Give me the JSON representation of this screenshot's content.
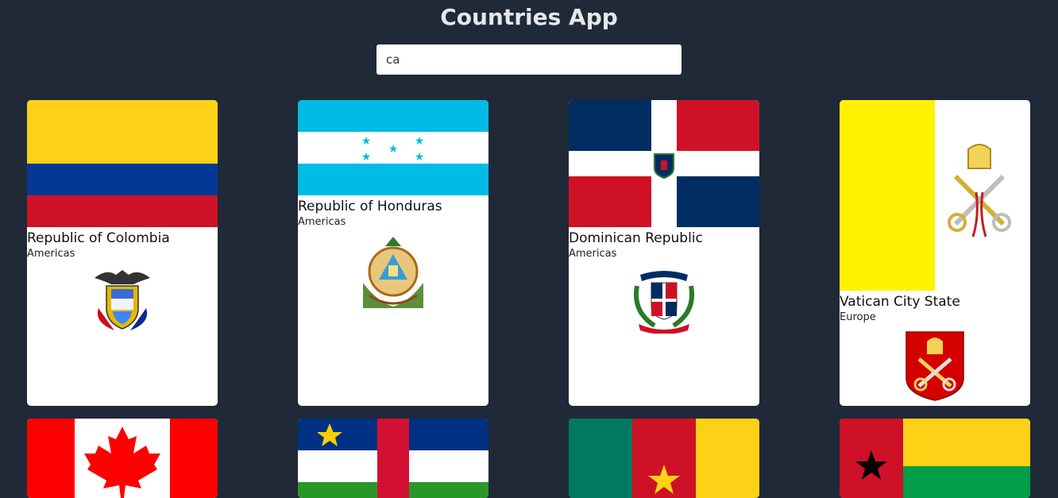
{
  "app": {
    "title": "Countries App"
  },
  "search": {
    "value": "ca"
  },
  "countries": [
    {
      "name": "Republic of Colombia",
      "region": "Americas"
    },
    {
      "name": "Republic of Honduras",
      "region": "Americas"
    },
    {
      "name": "Dominican Republic",
      "region": "Americas"
    },
    {
      "name": "Vatican City State",
      "region": "Europe"
    }
  ],
  "flags_row2": [
    "Canada",
    "Central African Republic",
    "Cameroon",
    "Guinea-Bissau"
  ],
  "colors": {
    "background": "#1f2937",
    "card": "#ffffff"
  }
}
